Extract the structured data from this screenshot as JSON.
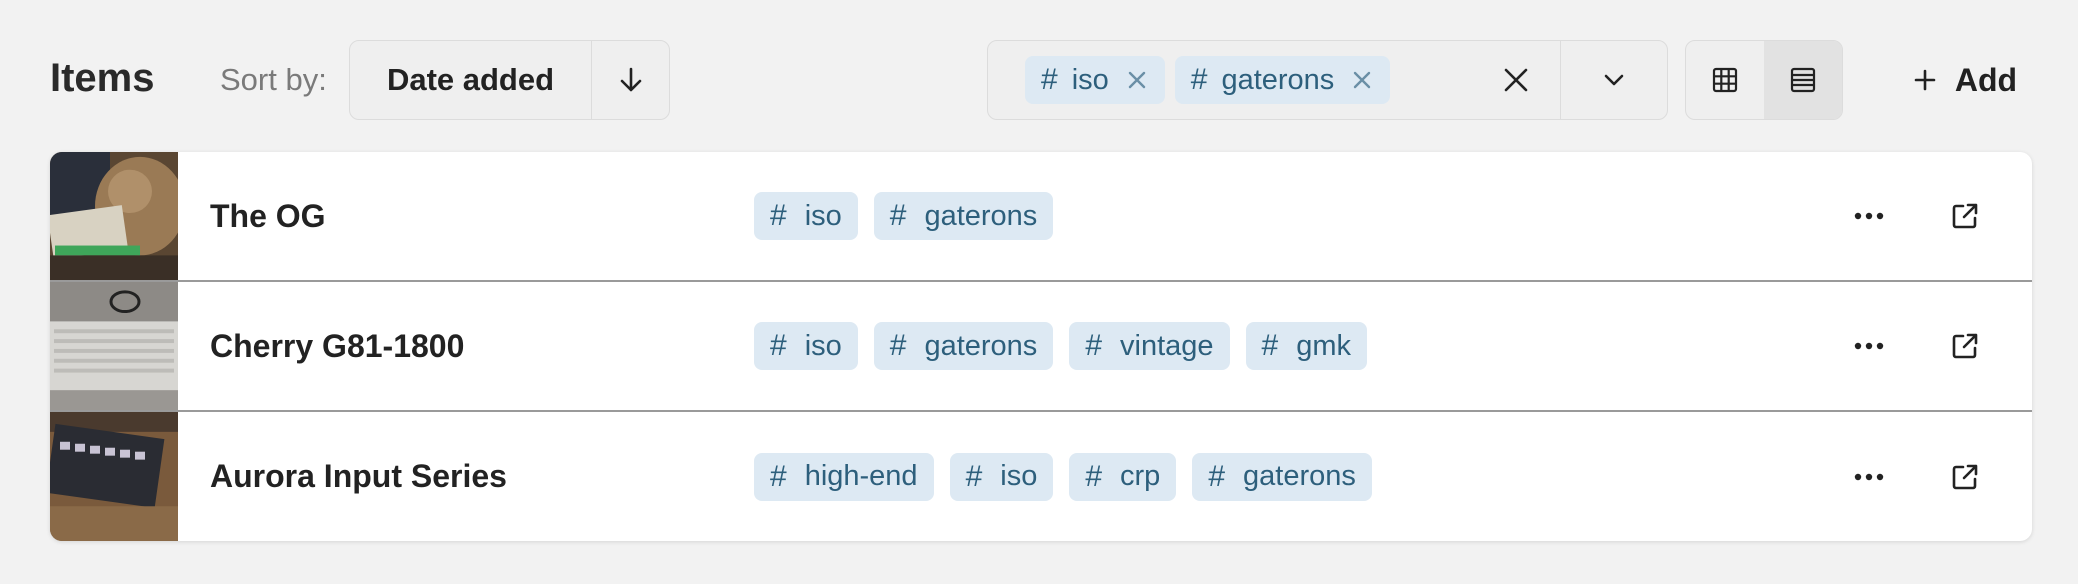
{
  "header": {
    "title": "Items",
    "sort_label": "Sort by:",
    "sort_value": "Date added",
    "sort_direction_icon": "arrow-down-icon",
    "filter_chips": [
      {
        "label": "iso"
      },
      {
        "label": "gaterons"
      }
    ],
    "add_label": "Add",
    "active_view": "list"
  },
  "items": [
    {
      "name": "The OG",
      "tags": [
        "iso",
        "gaterons"
      ]
    },
    {
      "name": "Cherry G81-1800",
      "tags": [
        "iso",
        "gaterons",
        "vintage",
        "gmk"
      ]
    },
    {
      "name": "Aurora Input Series",
      "tags": [
        "high-end",
        "iso",
        "crp",
        "gaterons"
      ]
    }
  ],
  "colors": {
    "tag_bg": "#dde9f3",
    "tag_text": "#2d5f7c",
    "background": "#f2f2f2"
  }
}
